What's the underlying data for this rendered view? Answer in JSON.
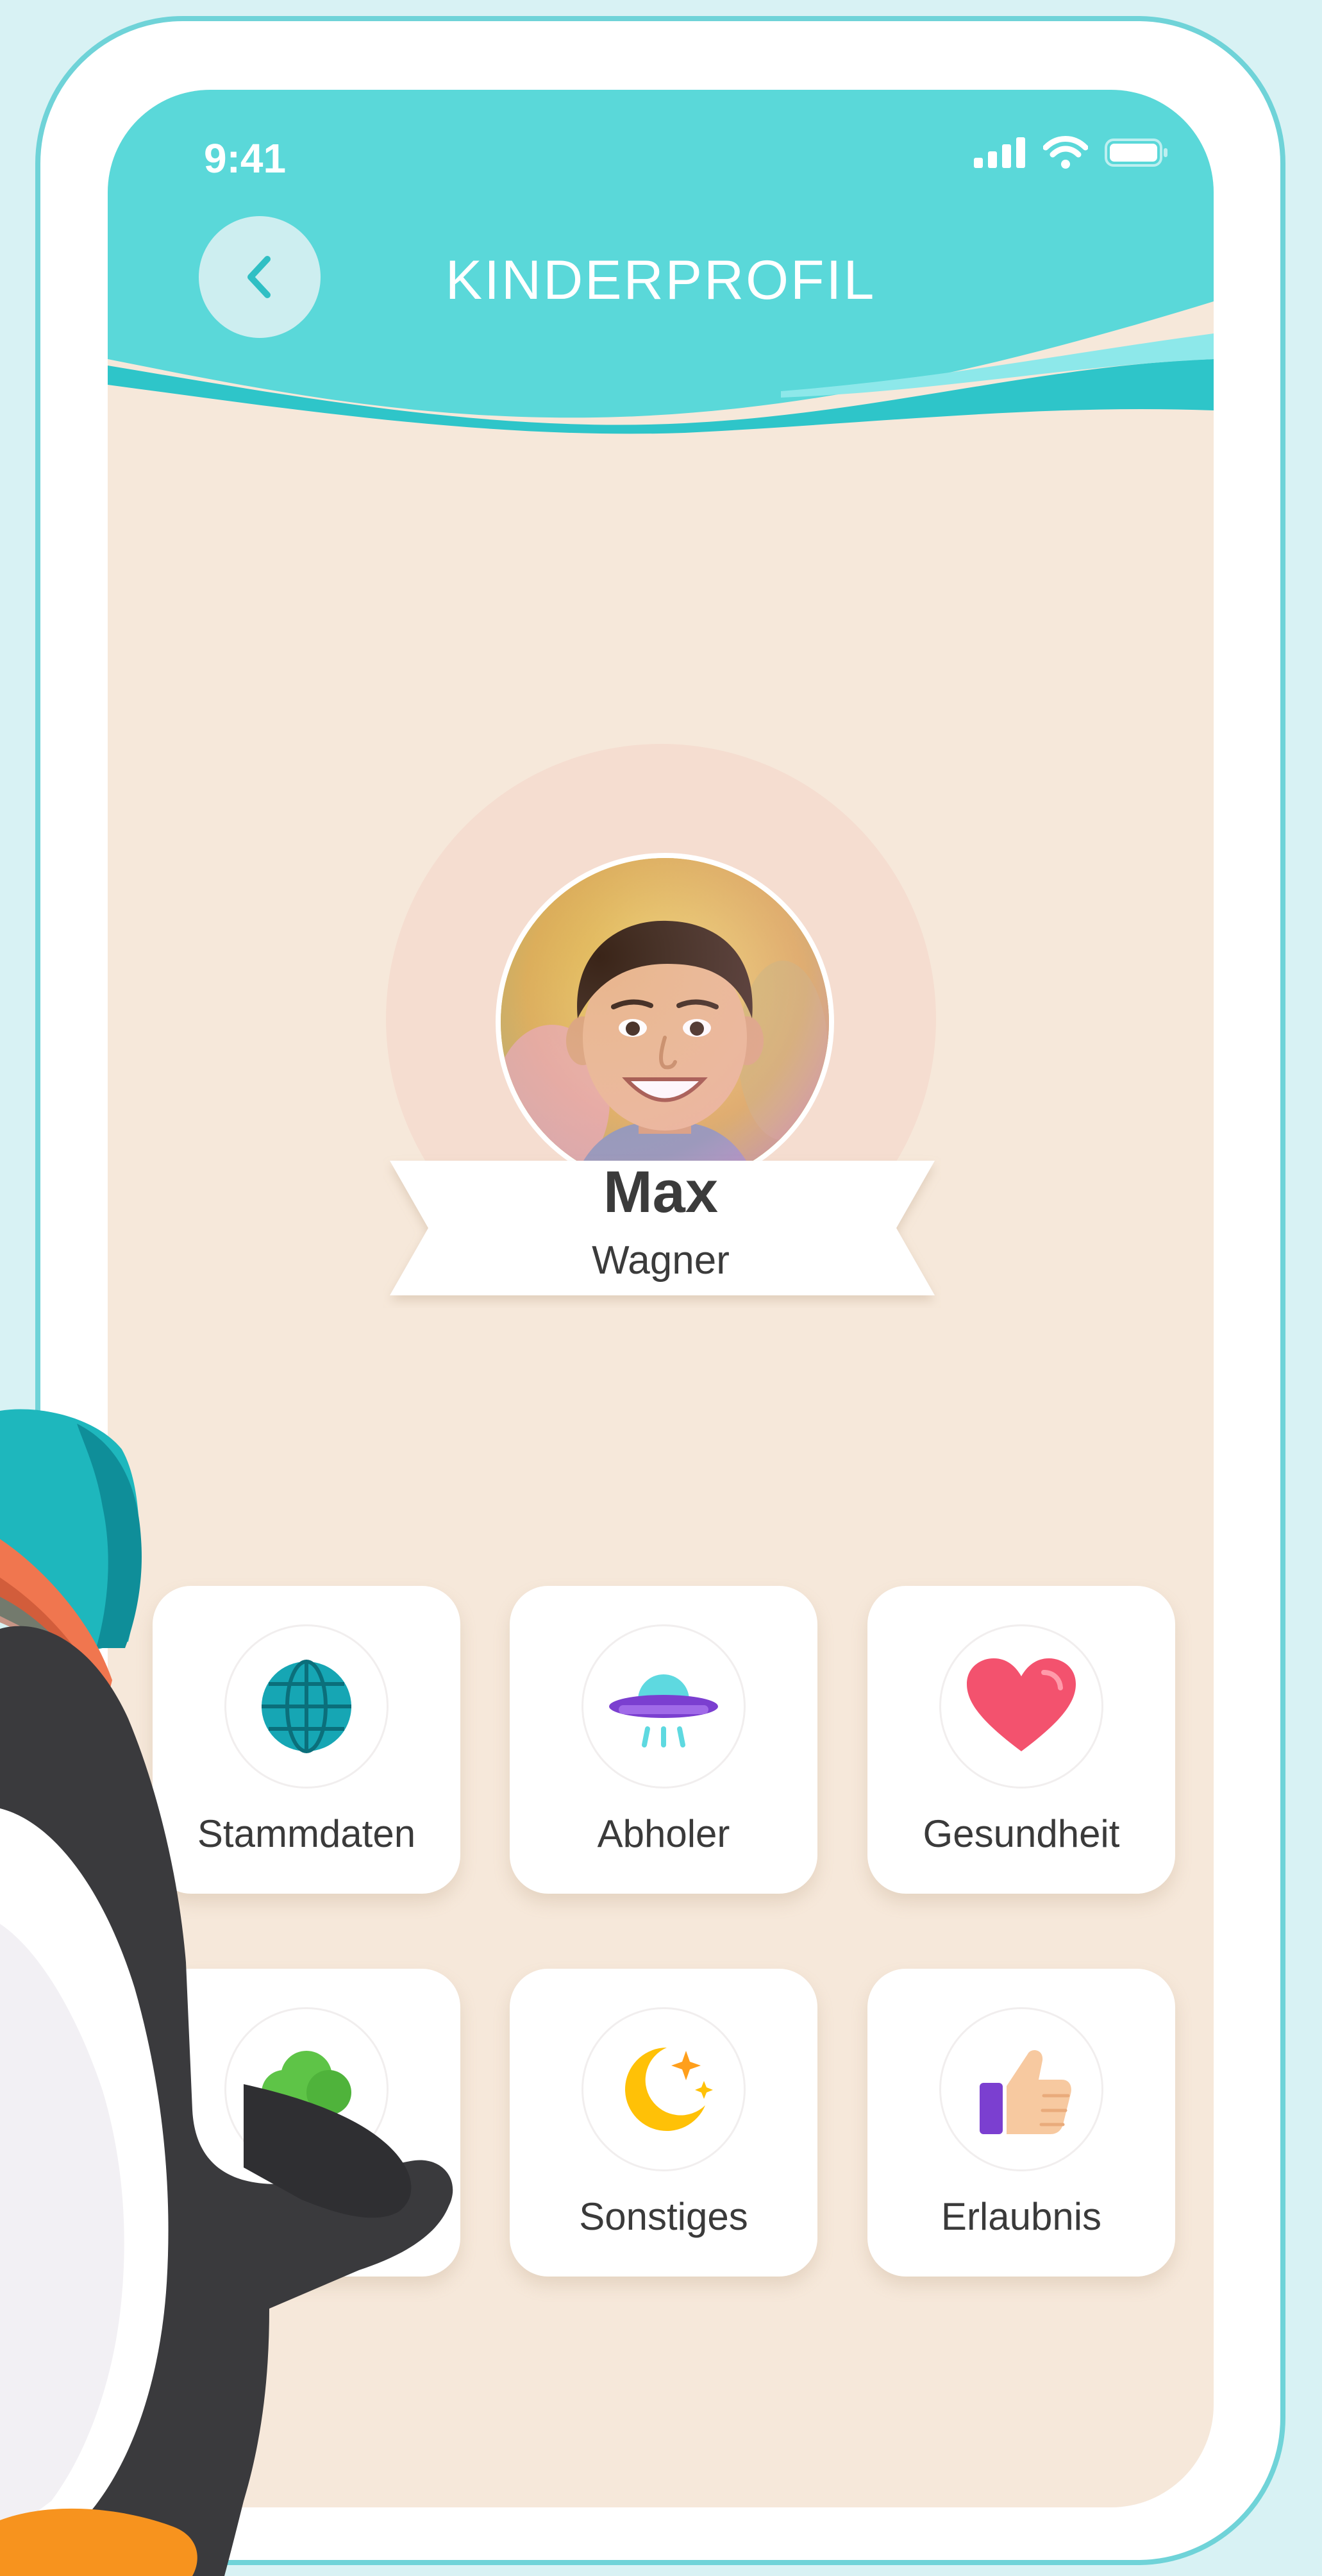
{
  "status_bar": {
    "time": "9:41"
  },
  "header": {
    "title": "KINDERPROFIL",
    "back_icon": "chevron-left-icon"
  },
  "profile": {
    "first_name": "Max",
    "last_name": "Wagner"
  },
  "menu": {
    "tiles": [
      {
        "label": "Stammdaten",
        "icon": "globe-icon"
      },
      {
        "label": "Abholer",
        "icon": "ufo-icon"
      },
      {
        "label": "Gesundheit",
        "icon": "heart-icon"
      },
      {
        "label": "",
        "icon": "tree-icon"
      },
      {
        "label": "Sonstiges",
        "icon": "moon-stars-icon"
      },
      {
        "label": "Erlaubnis",
        "icon": "thumbs-up-icon"
      }
    ]
  },
  "colors": {
    "accent": "#5ad8d9",
    "background": "#f6e8da",
    "heart": "#f3526e",
    "moon": "#ffc107",
    "ufo_purple": "#7b3fd0"
  }
}
